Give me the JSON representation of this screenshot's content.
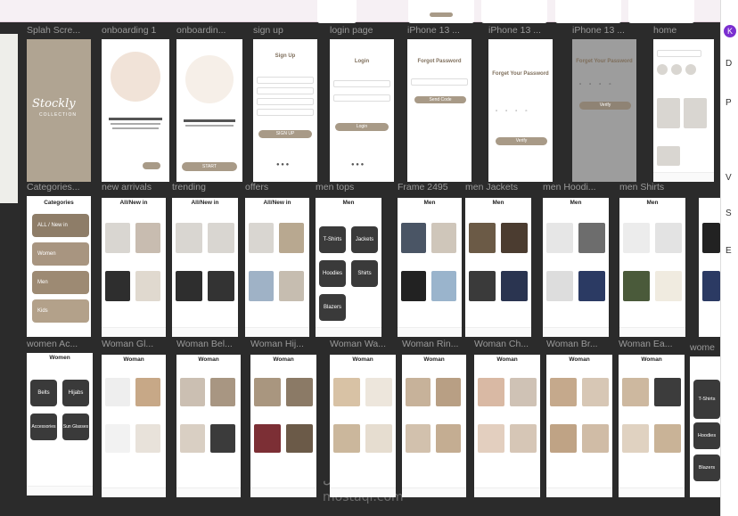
{
  "row1_labels": [
    "Splah Scre...",
    "onboarding 1",
    "onboardin...",
    "sign up",
    "login page",
    "iPhone 13 ...",
    "iPhone 13 ...",
    "iPhone 13 ...",
    "home"
  ],
  "row2_labels": [
    "Categories...",
    "new arrivals",
    "trending",
    "offers",
    "men tops",
    "Frame 2495",
    "men Jackets",
    "men Hoodi...",
    "men Shirts"
  ],
  "row3_labels": [
    "women Ac...",
    "Woman Gl...",
    "Woman Bel...",
    "Woman Hij...",
    "Woman Wa...",
    "Woman Rin...",
    "Woman Ch...",
    "Woman Br...",
    "Woman Ea...",
    "wome"
  ],
  "splash": {
    "logo": "Stockly",
    "sub": "COLLECTION"
  },
  "signup": {
    "title": "Sign Up",
    "button": "SIGN UP"
  },
  "login": {
    "title": "Login",
    "button": "Login"
  },
  "forgot": {
    "title": "Forgot Password",
    "button": "Send Code"
  },
  "forget2": {
    "title": "Forget Your Password",
    "button": "Verify"
  },
  "forget3": {
    "title": "Forget Your Password",
    "button": "Verify"
  },
  "onboarding": {
    "button": "START"
  },
  "categories_screen": {
    "title": "Categories",
    "items": [
      "ALL / New in",
      "Women",
      "Men",
      "Kids"
    ]
  },
  "frame_titles": {
    "new_arrivals": "All/New in",
    "trending": "All/New in",
    "offers": "All/New in",
    "men": "Men",
    "women": "Women",
    "woman": "Woman"
  },
  "men_tiles": [
    "T-Shirts",
    "Jackets",
    "Hoodies",
    "Shirts",
    "Blazers"
  ],
  "women_tiles": [
    "Belts",
    "Hijabs",
    "Accessories",
    "Sun Glasses"
  ],
  "side_tiles": [
    "T-Shirts",
    "Hoodies",
    "Blazers"
  ],
  "right_panel": {
    "avatar": "K",
    "letters": [
      "D",
      "P",
      "V",
      "S",
      "E"
    ]
  },
  "watermark": {
    "line1": "مستقل",
    "line2": "mostaql.com"
  }
}
